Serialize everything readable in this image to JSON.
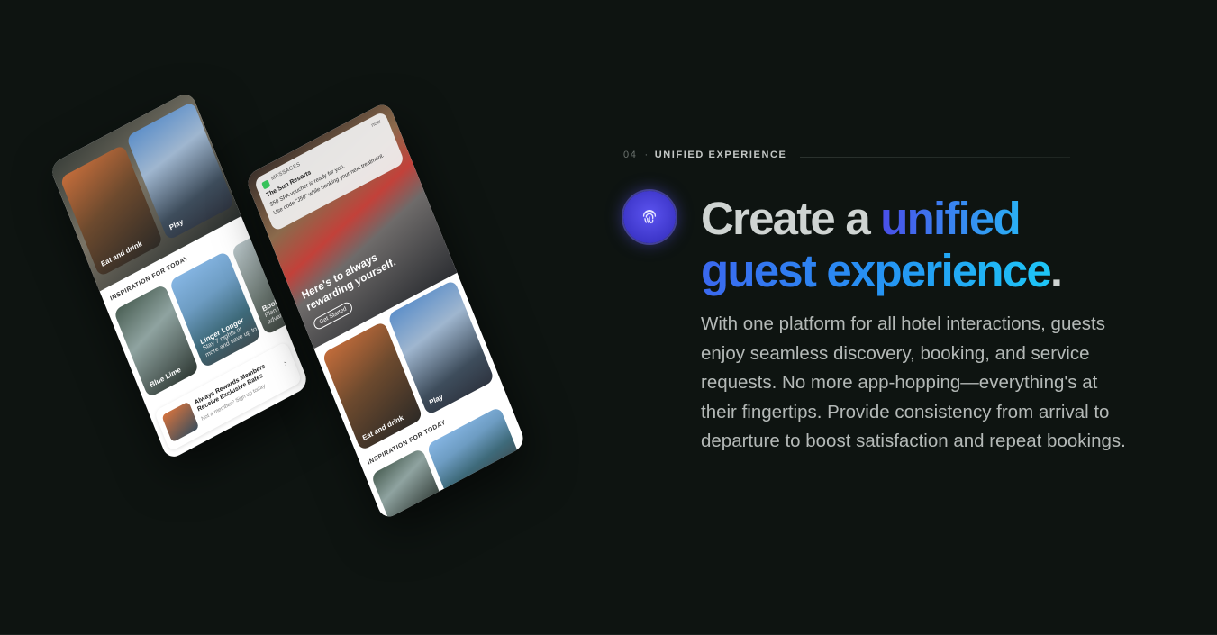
{
  "section": {
    "number": "04",
    "separator": "·",
    "label": "UNIFIED EXPERIENCE"
  },
  "badge": {
    "icon": "fingerprint-icon",
    "color": "#4b43e0"
  },
  "headline": {
    "plain": "Create a ",
    "highlight_1": "unified",
    "highlight_2": "guest experience",
    "period": "."
  },
  "body": "With one platform for all hotel interactions, guests enjoy seamless discovery, booking, and service requests. No more app-hopping—everything's at their fingertips. Provide consistency from arrival to departure to boost satisfaction and repeat bookings.",
  "phone_left": {
    "card_eat": "Eat and drink",
    "card_play": "Play",
    "inspiration_title": "INSPIRATION FOR TODAY",
    "card_lime": "Blue Lime",
    "card_linger_title": "Linger Longer",
    "card_linger_sub": "Stay 7 nights or more and save up to",
    "card_book_title": "Book",
    "card_book_sub": "Plan in advance",
    "rewards_title": "Always Rewards Members Receive Exclusive Rates",
    "rewards_sub": "Not a member? Sign up today",
    "chevron": "›"
  },
  "phone_right": {
    "notif_app": "MESSAGES",
    "notif_time": "now",
    "notif_title": "The Sun Resorts",
    "notif_line1": "$50 SPA voucher is ready for you.",
    "notif_line2": "Use code \"J50\" while booking your next treatment.",
    "hero_text": "Here's to always rewarding yourself.",
    "cta": "Get Started",
    "card_eat": "Eat and drink",
    "card_play": "Play",
    "inspiration_title": "INSPIRATION FOR TODAY"
  }
}
